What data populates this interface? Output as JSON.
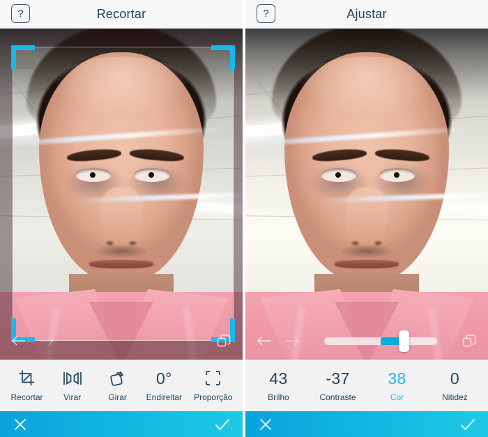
{
  "panels": [
    {
      "id": "crop",
      "header": {
        "help_label": "?",
        "title": "Recortar"
      },
      "photo_controls": {
        "undo_icon": "undo-arrow-icon",
        "redo_icon": "redo-arrow-icon",
        "layers_icon": "duplicate-layers-icon"
      },
      "toolbar": [
        {
          "icon": "crop-icon",
          "value": "",
          "label": "Recortar",
          "active": false
        },
        {
          "icon": "flip-icon",
          "value": "",
          "label": "Virar",
          "active": false
        },
        {
          "icon": "rotate-icon",
          "value": "",
          "label": "Girar",
          "active": false
        },
        {
          "icon": "degree-text",
          "value": "0°",
          "label": "Endireitar",
          "active": false
        },
        {
          "icon": "aspect-ratio-icon",
          "value": "",
          "label": "Proporção",
          "active": false
        }
      ],
      "bottombar": {
        "cancel_icon": "close-x-icon",
        "confirm_icon": "check-icon"
      }
    },
    {
      "id": "adjust",
      "header": {
        "help_label": "?",
        "title": "Ajustar"
      },
      "photo_controls": {
        "undo_icon": "undo-arrow-icon",
        "redo_icon": "redo-arrow-icon",
        "layers_icon": "duplicate-layers-icon",
        "slider": {
          "min": -100,
          "max": 100,
          "value": 38,
          "accent_color": "#0cadda"
        }
      },
      "toolbar": [
        {
          "icon": "",
          "value": "43",
          "label": "Brilho",
          "active": false
        },
        {
          "icon": "",
          "value": "-37",
          "label": "Contraste",
          "active": false
        },
        {
          "icon": "",
          "value": "38",
          "label": "Cor",
          "active": true
        },
        {
          "icon": "",
          "value": "0",
          "label": "Nitidez",
          "active": false
        }
      ],
      "bottombar": {
        "cancel_icon": "close-x-icon",
        "confirm_icon": "check-icon"
      }
    }
  ],
  "colors": {
    "accent_cyan": "#17b7e8",
    "crop_handle": "#16b9ea",
    "text_navy": "#21455e",
    "toolbar_bg": "#f2f2f2",
    "bar_gradient_from": "#0aa3dd",
    "bar_gradient_to": "#1fc9e4"
  }
}
